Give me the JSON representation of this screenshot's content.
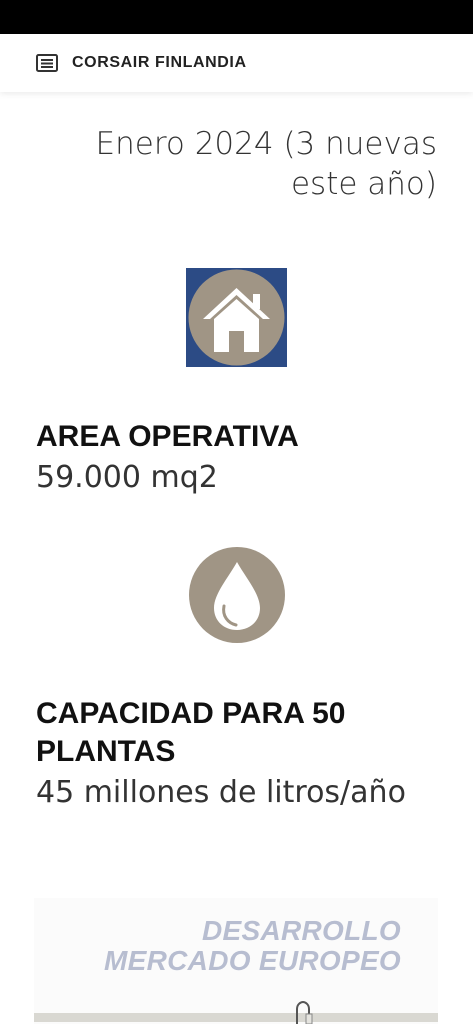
{
  "header": {
    "brand": "CORSAIR FINLANDIA",
    "menu_icon": "menu-list-icon"
  },
  "intro": {
    "date_text": "Enero 2024 (3 nuevas este año)"
  },
  "stats": [
    {
      "icon": "house-icon",
      "title": "AREA OPERATIVA",
      "value": "59.000 mq2"
    },
    {
      "icon": "water-drop-icon",
      "title": "CAPACIDAD PARA 50 PLANTAS",
      "value": "45 millones de litros/año"
    }
  ],
  "promo": {
    "line1": "DESARROLLO",
    "line2": "MERCADO EUROPEO"
  },
  "colors": {
    "icon_bg_blue": "#2c4b85",
    "icon_circle": "#a09585",
    "promo_text": "#b7bdd0"
  }
}
